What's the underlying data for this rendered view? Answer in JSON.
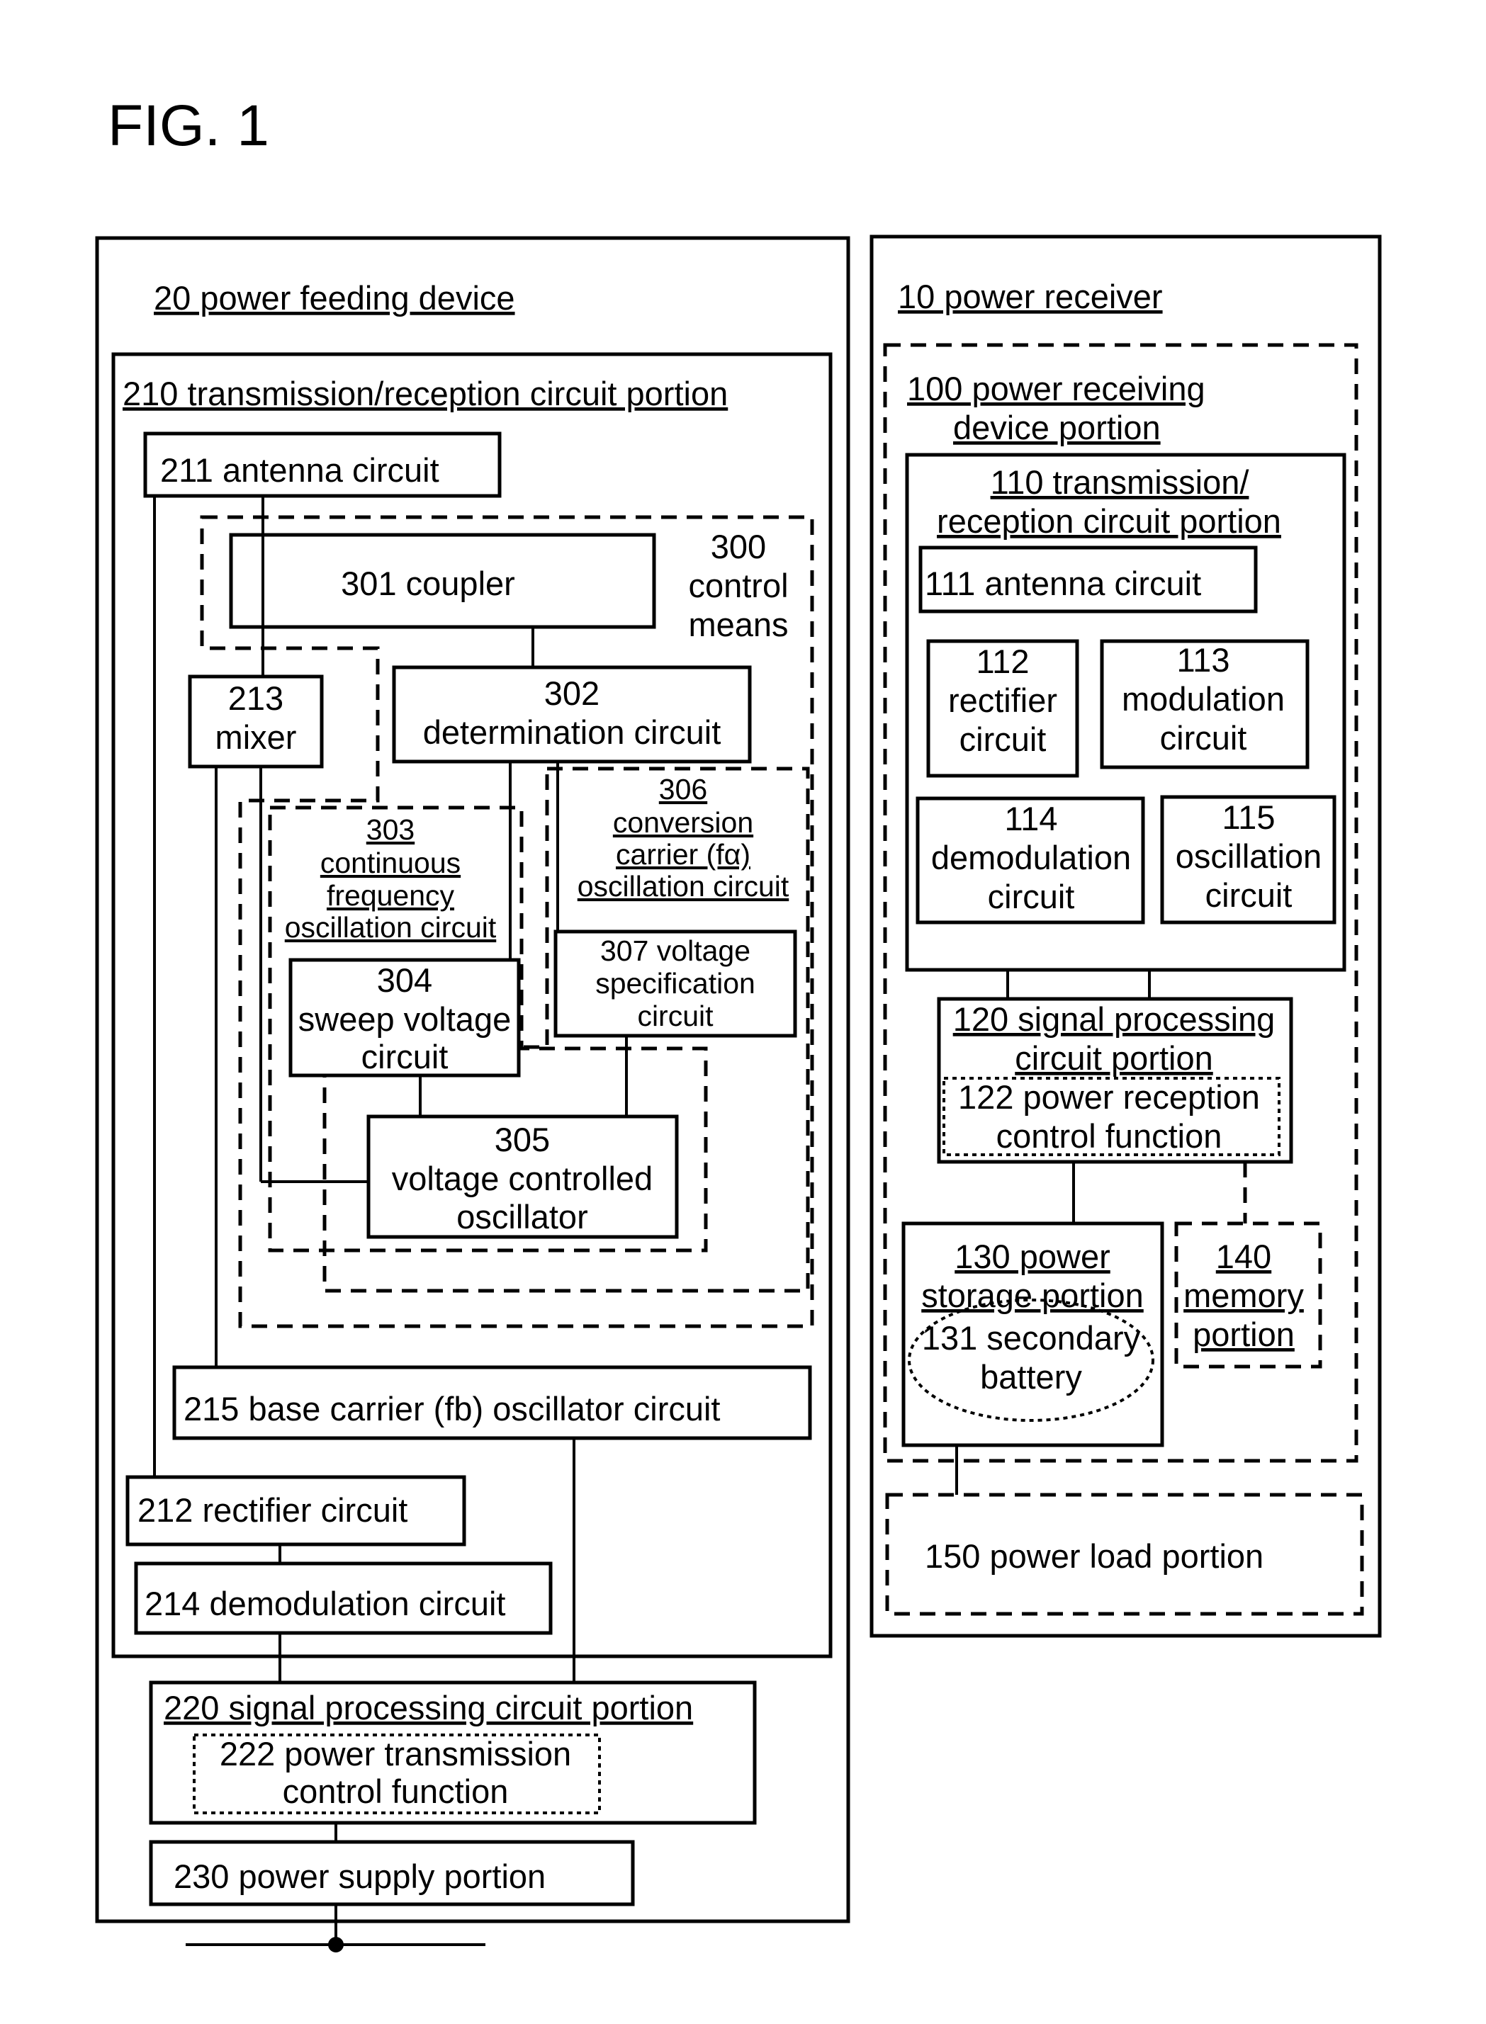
{
  "figure_title": "FIG. 1",
  "feeding": {
    "title": "20 power feeding device",
    "trx": "210  transmission/reception circuit portion",
    "antenna": "211   antenna circuit",
    "mixer": [
      "213",
      "mixer"
    ],
    "control": [
      "300",
      "control",
      "means"
    ],
    "coupler": "301 coupler",
    "determination": [
      "302",
      "determination circuit"
    ],
    "continuous": [
      "303",
      "continuous",
      "frequency",
      "oscillation circuit"
    ],
    "sweep": [
      "304",
      "sweep voltage",
      "circuit"
    ],
    "vco": [
      "305",
      "voltage controlled",
      "oscillator"
    ],
    "conversion": [
      "306",
      "conversion",
      "carrier (fα)",
      "oscillation circuit"
    ],
    "voltage_spec": [
      "307 voltage",
      "specification",
      "circuit"
    ],
    "base_carrier": "215   base carrier (fb) oscillator circuit",
    "rectifier": "212 rectifier circuit",
    "demodulation": "214 demodulation circuit",
    "signal": "220 signal processing circuit portion",
    "tx_control": [
      "222 power transmission",
      "control function"
    ],
    "power_supply": "230 power supply portion"
  },
  "receiver": {
    "title": "10 power receiver",
    "receiving": [
      "100 power receiving",
      "device portion"
    ],
    "trx": [
      "110 transmission/",
      "reception circuit portion"
    ],
    "antenna": "111 antenna circuit",
    "rectifier": [
      "112",
      "rectifier",
      "circuit"
    ],
    "modulation": [
      "113",
      "modulation",
      "circuit"
    ],
    "demodulation": [
      "114",
      "demodulation",
      "circuit"
    ],
    "oscillation": [
      "115",
      "oscillation",
      "circuit"
    ],
    "signal": [
      "120 signal processing",
      "circuit portion"
    ],
    "rx_control": [
      "122 power reception",
      "control function"
    ],
    "storage": [
      "130 power",
      "storage portion"
    ],
    "battery": [
      "131 secondary",
      "battery"
    ],
    "memory": [
      "140",
      "memory",
      "portion"
    ],
    "load": "150 power load portion"
  }
}
